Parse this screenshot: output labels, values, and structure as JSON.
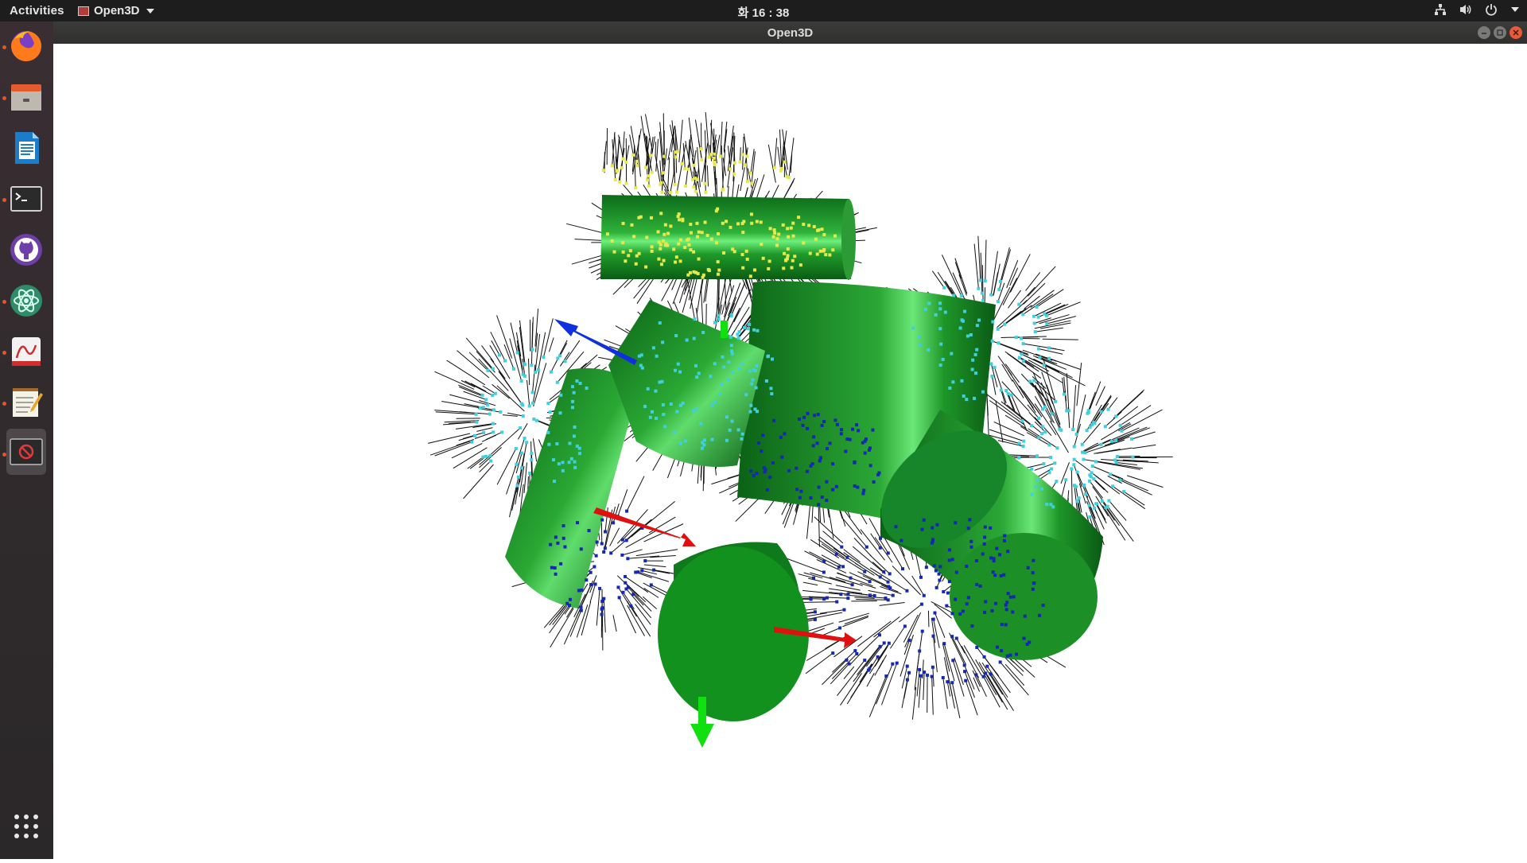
{
  "topbar": {
    "activities": "Activities",
    "app_name": "Open3D",
    "clock": "화 16 : 38"
  },
  "window": {
    "title": "Open3D"
  },
  "dock": {
    "items": [
      {
        "name": "firefox",
        "icon": "firefox-icon",
        "running": true
      },
      {
        "name": "files",
        "icon": "file-cabinet-icon",
        "running": true
      },
      {
        "name": "writer",
        "icon": "document-writer-icon",
        "running": false
      },
      {
        "name": "terminal",
        "icon": "terminal-icon",
        "running": true
      },
      {
        "name": "github",
        "icon": "github-icon",
        "running": false
      },
      {
        "name": "atom",
        "icon": "atom-icon",
        "running": true
      },
      {
        "name": "pdf-viewer",
        "icon": "pdf-icon",
        "running": true
      },
      {
        "name": "text-editor",
        "icon": "notepad-icon",
        "running": true
      },
      {
        "name": "open3d",
        "icon": "blocked-app-icon",
        "running": true,
        "active": true
      }
    ],
    "show_apps_icon": "app-grid-icon"
  },
  "scene": {
    "cylinder_color": "#1f9b2a",
    "cylinder_dark": "#0c6a18",
    "cylinder_light": "#5ee06a",
    "normals_color": "#111111",
    "point_colors": [
      "#e8e84a",
      "#3fd0e0",
      "#1428b4"
    ],
    "axis_colors": {
      "x": "#e01010",
      "y": "#10e010",
      "z": "#1030e0"
    }
  }
}
